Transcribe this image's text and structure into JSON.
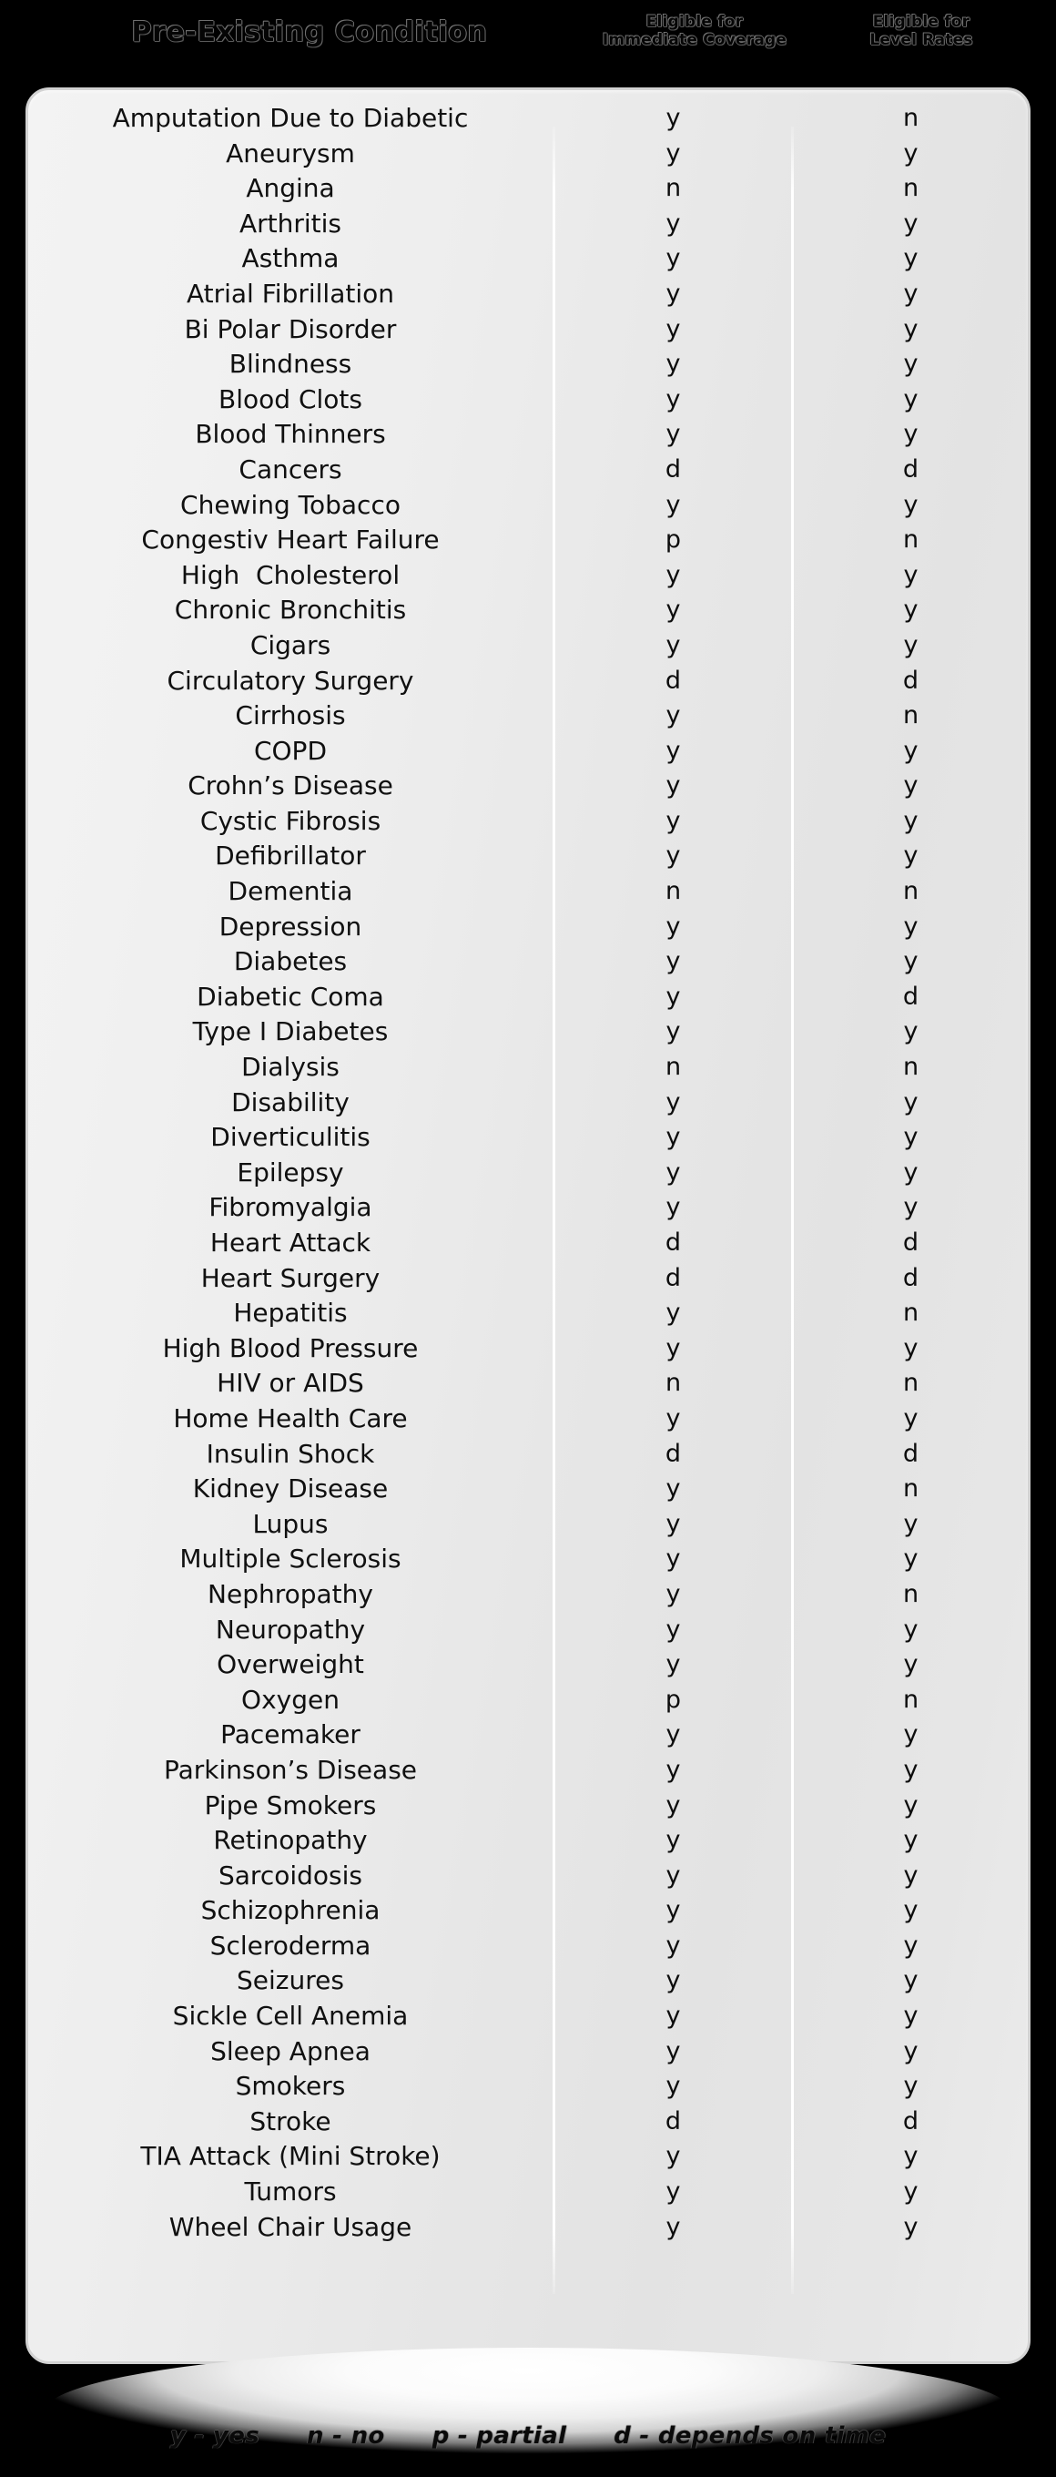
{
  "header": {
    "condition_label": "Pre-Existing Condition",
    "immediate_line1": "Eligible for",
    "immediate_line2": "Immediate Coverage",
    "level_line1": "Eligible for",
    "level_line2": "Level Rates"
  },
  "legend": [
    {
      "text": "y - yes"
    },
    {
      "text": "n - no"
    },
    {
      "text": "p - partial"
    },
    {
      "text": "d - depends on time"
    }
  ],
  "colors": {
    "page_background": "#000000",
    "card_background": "#ebebeb",
    "card_border": "#d2d2d2",
    "separator": "#ffffff",
    "text": "#101010"
  },
  "table": {
    "columns": [
      "Pre-Existing Condition",
      "Eligible for Immediate Coverage",
      "Eligible for Level Rates"
    ],
    "rows": [
      {
        "condition": "Amputation Due to Diabetic",
        "immediate": "y",
        "level": "n"
      },
      {
        "condition": "Aneurysm",
        "immediate": "y",
        "level": "y"
      },
      {
        "condition": "Angina",
        "immediate": "n",
        "level": "n"
      },
      {
        "condition": "Arthritis",
        "immediate": "y",
        "level": "y"
      },
      {
        "condition": "Asthma",
        "immediate": "y",
        "level": "y"
      },
      {
        "condition": "Atrial Fibrillation",
        "immediate": "y",
        "level": "y"
      },
      {
        "condition": "Bi Polar Disorder",
        "immediate": "y",
        "level": "y"
      },
      {
        "condition": "Blindness",
        "immediate": "y",
        "level": "y"
      },
      {
        "condition": "Blood Clots",
        "immediate": "y",
        "level": "y"
      },
      {
        "condition": "Blood Thinners",
        "immediate": "y",
        "level": "y"
      },
      {
        "condition": "Cancers",
        "immediate": "d",
        "level": "d"
      },
      {
        "condition": "Chewing Tobacco",
        "immediate": "y",
        "level": "y"
      },
      {
        "condition": "Congestiv Heart Failure",
        "immediate": "p",
        "level": "n"
      },
      {
        "condition": "High  Cholesterol",
        "immediate": "y",
        "level": "y"
      },
      {
        "condition": "Chronic Bronchitis",
        "immediate": "y",
        "level": "y"
      },
      {
        "condition": "Cigars",
        "immediate": "y",
        "level": "y"
      },
      {
        "condition": "Circulatory Surgery",
        "immediate": "d",
        "level": "d"
      },
      {
        "condition": "Cirrhosis",
        "immediate": "y",
        "level": "n"
      },
      {
        "condition": "COPD",
        "immediate": "y",
        "level": "y"
      },
      {
        "condition": "Crohn’s Disease",
        "immediate": "y",
        "level": "y"
      },
      {
        "condition": "Cystic Fibrosis",
        "immediate": "y",
        "level": "y"
      },
      {
        "condition": "Defibrillator",
        "immediate": "y",
        "level": "y"
      },
      {
        "condition": "Dementia",
        "immediate": "n",
        "level": "n"
      },
      {
        "condition": "Depression",
        "immediate": "y",
        "level": "y"
      },
      {
        "condition": "Diabetes",
        "immediate": "y",
        "level": "y"
      },
      {
        "condition": "Diabetic Coma",
        "immediate": "y",
        "level": "d"
      },
      {
        "condition": "Type I Diabetes",
        "immediate": "y",
        "level": "y"
      },
      {
        "condition": "Dialysis",
        "immediate": "n",
        "level": "n"
      },
      {
        "condition": "Disability",
        "immediate": "y",
        "level": "y"
      },
      {
        "condition": "Diverticulitis",
        "immediate": "y",
        "level": "y"
      },
      {
        "condition": "Epilepsy",
        "immediate": "y",
        "level": "y"
      },
      {
        "condition": "Fibromyalgia",
        "immediate": "y",
        "level": "y"
      },
      {
        "condition": "Heart Attack",
        "immediate": "d",
        "level": "d"
      },
      {
        "condition": "Heart Surgery",
        "immediate": "d",
        "level": "d"
      },
      {
        "condition": "Hepatitis",
        "immediate": "y",
        "level": "n"
      },
      {
        "condition": "High Blood Pressure",
        "immediate": "y",
        "level": "y"
      },
      {
        "condition": "HIV or AIDS",
        "immediate": "n",
        "level": "n"
      },
      {
        "condition": "Home Health Care",
        "immediate": "y",
        "level": "y"
      },
      {
        "condition": "Insulin Shock",
        "immediate": "d",
        "level": "d"
      },
      {
        "condition": "Kidney Disease",
        "immediate": "y",
        "level": "n"
      },
      {
        "condition": "Lupus",
        "immediate": "y",
        "level": "y"
      },
      {
        "condition": "Multiple Sclerosis",
        "immediate": "y",
        "level": "y"
      },
      {
        "condition": "Nephropathy",
        "immediate": "y",
        "level": "n"
      },
      {
        "condition": "Neuropathy",
        "immediate": "y",
        "level": "y"
      },
      {
        "condition": "Overweight",
        "immediate": "y",
        "level": "y"
      },
      {
        "condition": "Oxygen",
        "immediate": "p",
        "level": "n"
      },
      {
        "condition": "Pacemaker",
        "immediate": "y",
        "level": "y"
      },
      {
        "condition": "Parkinson’s Disease",
        "immediate": "y",
        "level": "y"
      },
      {
        "condition": "Pipe Smokers",
        "immediate": "y",
        "level": "y"
      },
      {
        "condition": "Retinopathy",
        "immediate": "y",
        "level": "y"
      },
      {
        "condition": "Sarcoidosis",
        "immediate": "y",
        "level": "y"
      },
      {
        "condition": "Schizophrenia",
        "immediate": "y",
        "level": "y"
      },
      {
        "condition": "Scleroderma",
        "immediate": "y",
        "level": "y"
      },
      {
        "condition": "Seizures",
        "immediate": "y",
        "level": "y"
      },
      {
        "condition": "Sickle Cell Anemia",
        "immediate": "y",
        "level": "y"
      },
      {
        "condition": "Sleep Apnea",
        "immediate": "y",
        "level": "y"
      },
      {
        "condition": "Smokers",
        "immediate": "y",
        "level": "y"
      },
      {
        "condition": "Stroke",
        "immediate": "d",
        "level": "d"
      },
      {
        "condition": "TIA Attack (Mini Stroke)",
        "immediate": "y",
        "level": "y"
      },
      {
        "condition": "Tumors",
        "immediate": "y",
        "level": "y"
      },
      {
        "condition": "Wheel Chair Usage",
        "immediate": "y",
        "level": "y"
      }
    ]
  }
}
